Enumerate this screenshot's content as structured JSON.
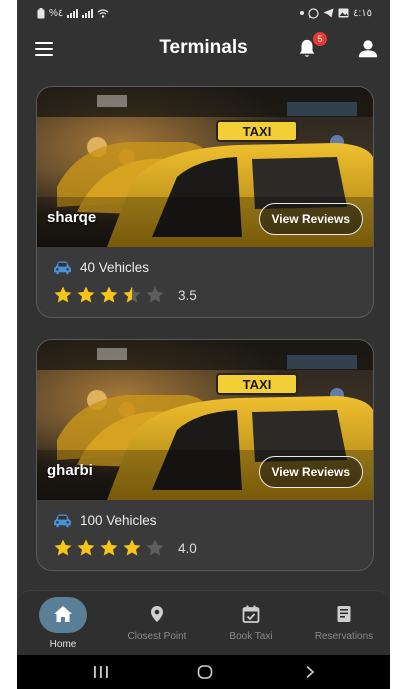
{
  "status_bar": {
    "left_text": "%٤",
    "right_time": "٤:١٥"
  },
  "header": {
    "title": "Terminals",
    "notification_count": "5"
  },
  "terminals": [
    {
      "name": "sharqe",
      "button_label": "View Reviews",
      "vehicles": "40 Vehicles",
      "rating": 3.5,
      "rating_label": "3.5",
      "sign_text": "TAXI"
    },
    {
      "name": "gharbi",
      "button_label": "View Reviews",
      "vehicles": "100 Vehicles",
      "rating": 4.0,
      "rating_label": "4.0",
      "sign_text": "TAXI"
    }
  ],
  "bottom_nav": {
    "items": [
      {
        "label": "Home",
        "icon": "home-icon",
        "active": true
      },
      {
        "label": "Closest Point",
        "icon": "location-pin-icon",
        "active": false
      },
      {
        "label": "Book Taxi",
        "icon": "calendar-check-icon",
        "active": false
      },
      {
        "label": "Reservations",
        "icon": "reservations-icon",
        "active": false
      }
    ]
  },
  "colors": {
    "background": "#323232",
    "star": "#f5c518",
    "star_empty": "#5e5e5e",
    "car_icon": "#4a90d9",
    "active_nav": "#5a7f96",
    "badge": "#e53935"
  }
}
